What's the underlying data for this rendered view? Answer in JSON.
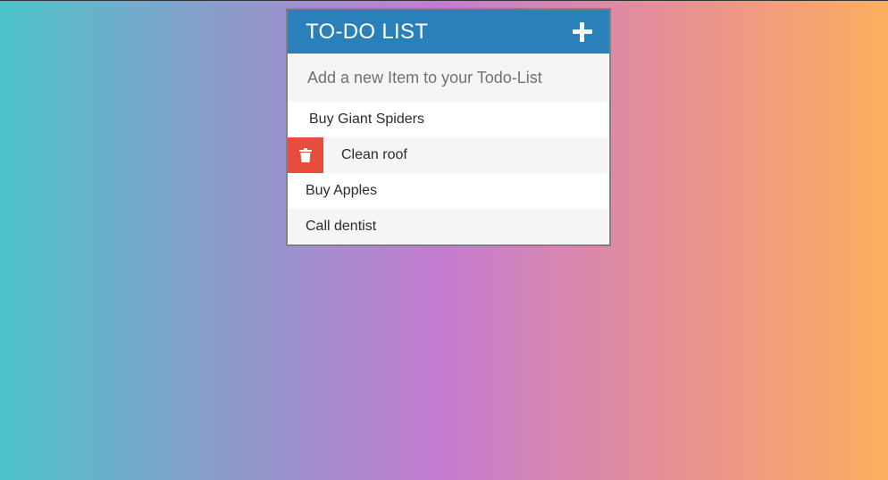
{
  "todo": {
    "title": "TO-DO LIST",
    "add_icon": "plus-icon",
    "input_placeholder": "Add a new Item to your Todo-List",
    "input_value": "",
    "items": [
      {
        "label": "Buy Giant Spiders",
        "show_delete": false
      },
      {
        "label": "Clean roof",
        "show_delete": true,
        "delete_icon": "trash-icon"
      },
      {
        "label": "Buy Apples",
        "show_delete": false
      },
      {
        "label": "Call dentist",
        "show_delete": false
      }
    ]
  },
  "colors": {
    "header": "#2a80b9",
    "delete": "#e74c3c",
    "row_odd": "#ffffff",
    "row_even": "#f5f5f5",
    "gradient": [
      "#4cc3c9",
      "#c57cd0",
      "#feae5f"
    ]
  }
}
